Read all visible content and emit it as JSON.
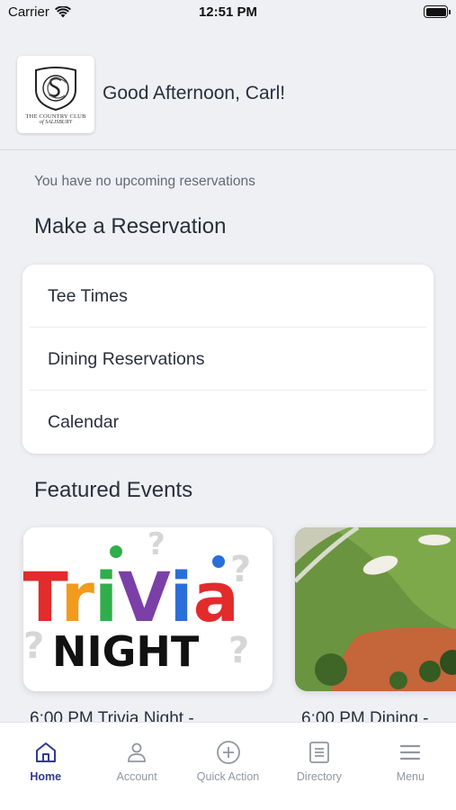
{
  "status_bar": {
    "carrier": "Carrier",
    "time": "12:51 PM"
  },
  "header": {
    "logo_line1": "THE COUNTRY CLUB",
    "logo_line2": "of SALISBURY",
    "greeting": "Good Afternoon, Carl!"
  },
  "reservations": {
    "none_text": "You have no upcoming reservations",
    "section_title": "Make a Reservation",
    "items": [
      {
        "label": "Tee Times"
      },
      {
        "label": "Dining Reservations"
      },
      {
        "label": "Calendar"
      }
    ]
  },
  "featured": {
    "section_title": "Featured Events",
    "events": [
      {
        "caption": "6:00 PM  Trivia Night -",
        "image_word1": "Trivia",
        "image_word2": "NIGHT"
      },
      {
        "caption": "6:00 PM Dining -"
      }
    ]
  },
  "tabs": [
    {
      "label": "Home",
      "icon": "home-icon",
      "active": true
    },
    {
      "label": "Account",
      "icon": "person-icon",
      "active": false
    },
    {
      "label": "Quick Action",
      "icon": "plus-circle-icon",
      "active": false
    },
    {
      "label": "Directory",
      "icon": "directory-icon",
      "active": false
    },
    {
      "label": "Menu",
      "icon": "menu-icon",
      "active": false
    }
  ],
  "colors": {
    "accent": "#2f3a8f",
    "background": "#eff0f4",
    "inactive_tab": "#9196a1"
  }
}
